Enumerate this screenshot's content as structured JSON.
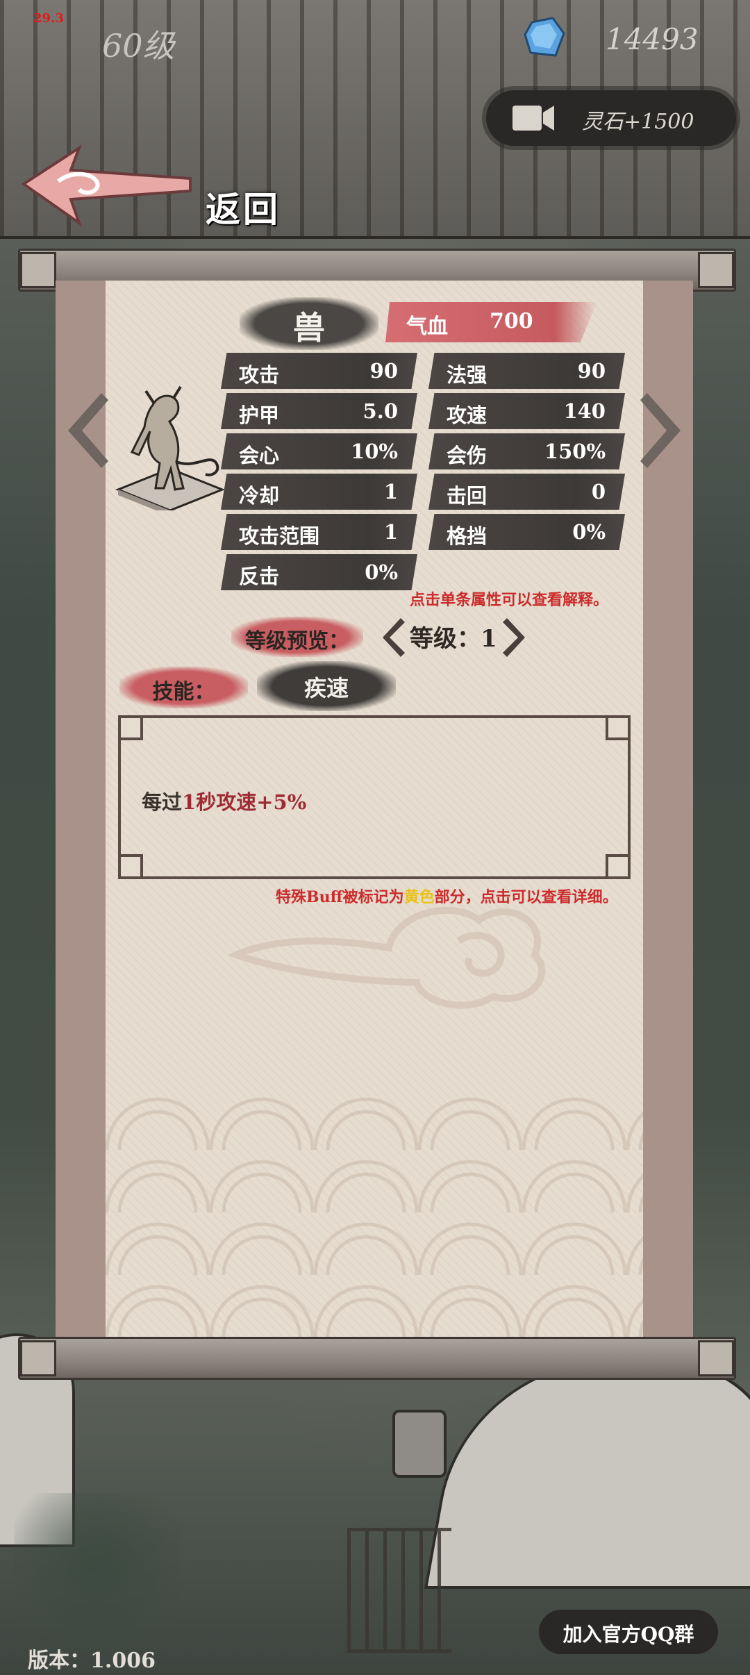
{
  "top_bar": {
    "badge": "29.3",
    "level": "60级",
    "spirit_stones": "14493",
    "video_reward": "灵石+1500"
  },
  "back": {
    "label": "返回"
  },
  "unit": {
    "name": "兽",
    "hp_label": "气血",
    "hp_value": "700"
  },
  "stats": [
    {
      "key": "攻击",
      "value": "90"
    },
    {
      "key": "法强",
      "value": "90"
    },
    {
      "key": "护甲",
      "value": "5.0"
    },
    {
      "key": "攻速",
      "value": "140"
    },
    {
      "key": "会心",
      "value": "10%"
    },
    {
      "key": "会伤",
      "value": "150%"
    },
    {
      "key": "冷却",
      "value": "1"
    },
    {
      "key": "击回",
      "value": "0"
    },
    {
      "key": "攻击范围",
      "value": "1"
    },
    {
      "key": "格挡",
      "value": "0%"
    },
    {
      "key": "反击",
      "value": "0%"
    }
  ],
  "stat_hint": "点击单条属性可以查看解释。",
  "level_preview": {
    "label": "等级预览：",
    "level_text": "等级：1"
  },
  "skill": {
    "label": "技能：",
    "name": "疾速",
    "desc_pre": "每过",
    "desc_time": "1秒",
    "desc_attr": "攻速",
    "desc_bonus": "+5%"
  },
  "buff_hint": {
    "pre": "特殊Buff被标记为",
    "yellow": "黄色",
    "post": "部分，点击可以查看详细。"
  },
  "qq_button": "加入官方QQ群",
  "version": "版本：1.006",
  "colors": {
    "accent_red": "#c85e62",
    "stat_bg": "#3d3937",
    "paper": "#e6ddd0",
    "hint_red": "#cc2b2b",
    "buff_yellow": "#e8c21c"
  }
}
